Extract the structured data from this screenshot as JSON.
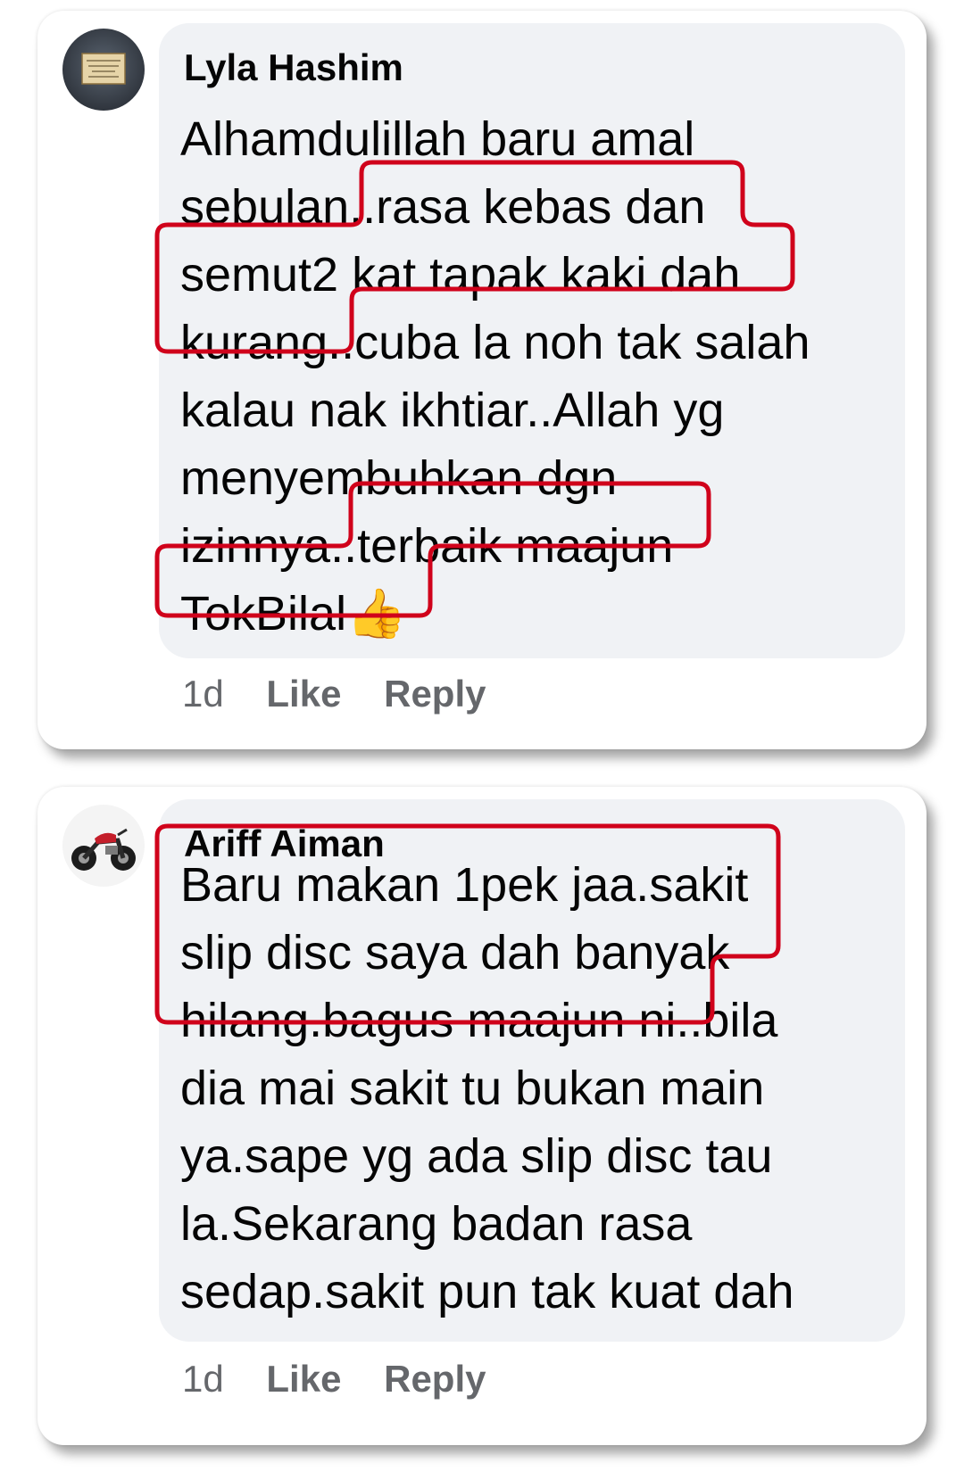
{
  "comments": [
    {
      "author": "Lyla Hashim",
      "avatar_icon": "avatar-placard-icon",
      "lines": [
        "Alhamdulillah baru amal",
        "sebulan..rasa kebas dan",
        "semut2 kat tapak kaki dah",
        "kurang..cuba la noh tak salah",
        "kalau nak ikhtiar..Allah yg",
        "menyembuhkan dgn",
        "izinnya..terbaik maajun",
        "TokBilal👍"
      ],
      "time": "1d",
      "like_label": "Like",
      "reply_label": "Reply"
    },
    {
      "author": "Ariff Aiman",
      "avatar_icon": "motorcycle-icon",
      "lines": [
        "Baru makan 1pek jaa.sakit",
        "slip disc saya dah banyak",
        "hilang.bagus maajun ni..bila",
        "dia mai sakit tu bukan main",
        "ya.sape yg ada slip disc tau",
        "la.Sekarang badan rasa",
        "sedap.sakit pun tak kuat dah"
      ],
      "time": "1d",
      "like_label": "Like",
      "reply_label": "Reply"
    }
  ],
  "colors": {
    "card_bg": "#ffffff",
    "bubble_bg": "#f0f2f5",
    "text": "#050505",
    "meta": "#65676b",
    "highlight": "#d0021b"
  }
}
